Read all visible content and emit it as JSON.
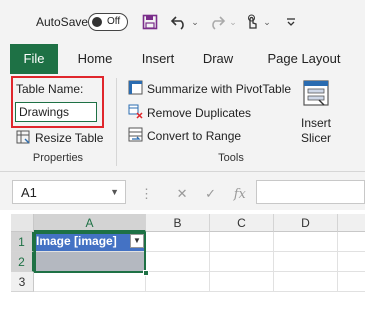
{
  "title_bar": {
    "autosave_label": "AutoSave",
    "toggle_state": "Off",
    "icons": [
      "save-icon",
      "undo-icon",
      "redo-icon",
      "touch-mode-icon",
      "customize-qat-icon"
    ]
  },
  "tabs": [
    "File",
    "Home",
    "Insert",
    "Draw",
    "Page Layout"
  ],
  "ribbon": {
    "properties": {
      "table_name_label": "Table Name:",
      "table_name_value": "Drawings",
      "resize_label": "Resize Table",
      "group_label": "Properties"
    },
    "tools": {
      "summarize": "Summarize with PivotTable",
      "remove_duplicates": "Remove Duplicates",
      "convert_to_range": "Convert to Range",
      "group_label": "Tools"
    },
    "slicer": {
      "line1": "Insert",
      "line2": "Slicer"
    }
  },
  "formula_bar": {
    "name_box": "A1",
    "fx_label": "fx",
    "formula": ""
  },
  "grid": {
    "columns": [
      "A",
      "B",
      "C",
      "D"
    ],
    "rows": [
      "1",
      "2",
      "3"
    ],
    "header_cell": "Image [image]"
  },
  "colors": {
    "excel_green": "#1e7145",
    "table_header_blue": "#4472c4",
    "highlight_red": "#e0262c"
  }
}
